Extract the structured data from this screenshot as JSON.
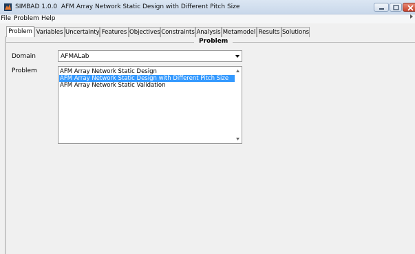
{
  "window": {
    "app_name": "SIMBAD 1.0.0",
    "title": "AFM Array Network Static Design with Different Pitch Size"
  },
  "menu": {
    "file": "File",
    "problem": "Problem",
    "help": "Help"
  },
  "tabs": [
    {
      "label": "Problem",
      "active": true
    },
    {
      "label": "Variables"
    },
    {
      "label": "Uncertainty"
    },
    {
      "label": "Features"
    },
    {
      "label": "Objectives"
    },
    {
      "label": "Constraints"
    },
    {
      "label": "Analysis"
    },
    {
      "label": "Metamodel"
    },
    {
      "label": "Results"
    },
    {
      "label": "Solutions"
    }
  ],
  "panel": {
    "title": "Problem",
    "domain_label": "Domain",
    "domain_value": "AFMALab",
    "problem_label": "Problem",
    "problems": [
      "AFM Array Network Static Design",
      "AFM Array Network Static Design with Different Pitch Size",
      "AFM Array Network Static Validation"
    ],
    "selected_index": 1
  },
  "colors": {
    "selection": "#3399ff",
    "titlebar": "#dbe6f3"
  },
  "icons": {
    "app": "matlab-icon",
    "minimize": "minimize-icon",
    "maximize": "maximize-icon",
    "close": "close-icon"
  }
}
